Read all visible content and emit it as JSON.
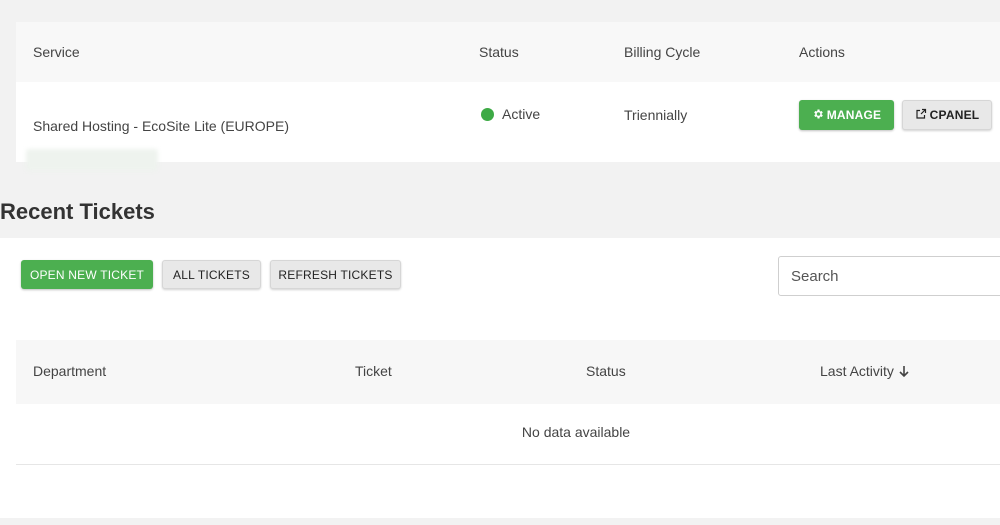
{
  "services": {
    "headers": {
      "service": "Service",
      "status": "Status",
      "billing_cycle": "Billing Cycle",
      "actions": "Actions"
    },
    "row": {
      "product": "Shared Hosting - EcoSite Lite (EUROPE)",
      "status": "Active",
      "billing_cycle": "Triennially",
      "manage_label": "MANAGE",
      "cpanel_label": "CPANEL"
    },
    "colors": {
      "active": "#3daa45",
      "primary": "#4caf50"
    }
  },
  "tickets": {
    "title": "Recent Tickets",
    "buttons": {
      "open_new": "OPEN NEW TICKET",
      "all": "ALL TICKETS",
      "refresh": "REFRESH TICKETS"
    },
    "search": {
      "placeholder": "Search",
      "value": ""
    },
    "headers": {
      "department": "Department",
      "ticket": "Ticket",
      "status": "Status",
      "last_activity": "Last Activity"
    },
    "sort_icon": "arrow-down-icon",
    "empty_message": "No data available"
  }
}
